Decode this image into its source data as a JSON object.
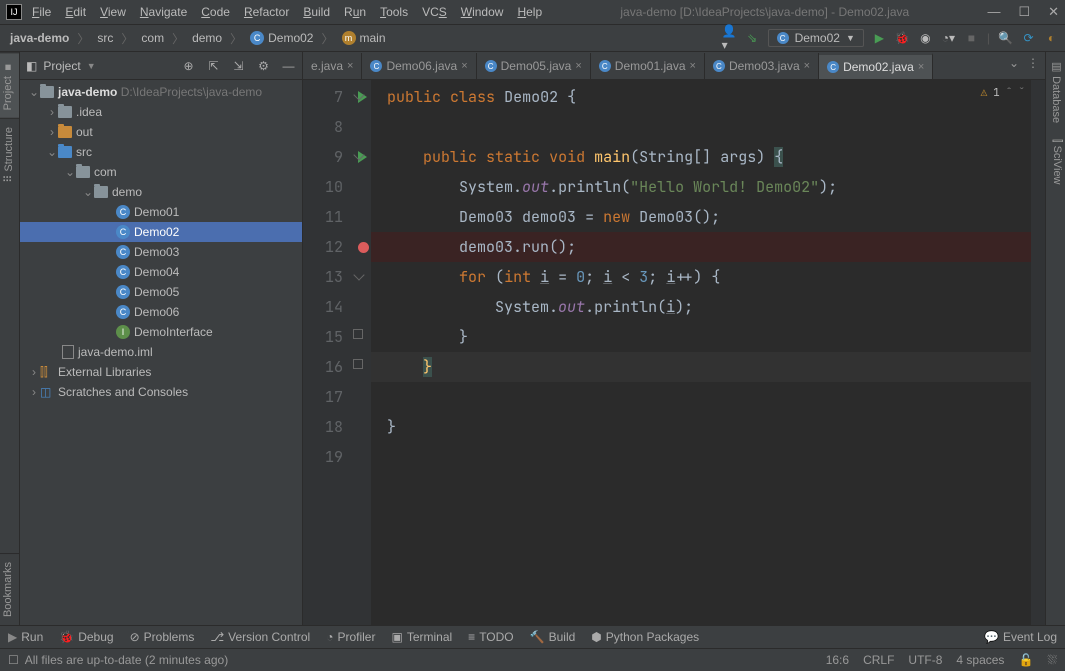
{
  "title": "java-demo [D:\\IdeaProjects\\java-demo] - Demo02.java",
  "menu": [
    "File",
    "Edit",
    "View",
    "Navigate",
    "Code",
    "Refactor",
    "Build",
    "Run",
    "Tools",
    "VCS",
    "Window",
    "Help"
  ],
  "breadcrumb": {
    "project": "java-demo",
    "p1": "src",
    "p2": "com",
    "p3": "demo",
    "cls": "Demo02",
    "method": "main"
  },
  "run_config": "Demo02",
  "left_tabs": {
    "project": "Project",
    "structure": "Structure",
    "bookmarks": "Bookmarks"
  },
  "right_tabs": {
    "database": "Database",
    "sciview": "SciView"
  },
  "project_panel": {
    "title": "Project"
  },
  "tree": {
    "project_name": "java-demo",
    "project_path": "D:\\IdeaProjects\\java-demo",
    "idea": ".idea",
    "out": "out",
    "src": "src",
    "com": "com",
    "demo": "demo",
    "demo01": "Demo01",
    "demo02": "Demo02",
    "demo03": "Demo03",
    "demo04": "Demo04",
    "demo05": "Demo05",
    "demo06": "Demo06",
    "demoiface": "DemoInterface",
    "iml": "java-demo.iml",
    "external": "External Libraries",
    "scratches": "Scratches and Consoles"
  },
  "tabs": {
    "t0": "e.java",
    "t1": "Demo06.java",
    "t2": "Demo05.java",
    "t3": "Demo01.java",
    "t4": "Demo03.java",
    "t5": "Demo02.java"
  },
  "gutter_lines": [
    "7",
    "8",
    "9",
    "10",
    "11",
    "12",
    "13",
    "14",
    "15",
    "16",
    "17",
    "18",
    "19"
  ],
  "warning_count": "1",
  "bottom": {
    "run": "Run",
    "debug": "Debug",
    "problems": "Problems",
    "vcs": "Version Control",
    "profiler": "Profiler",
    "terminal": "Terminal",
    "todo": "TODO",
    "build": "Build",
    "python": "Python Packages",
    "eventlog": "Event Log"
  },
  "status": {
    "message": "All files are up-to-date (2 minutes ago)",
    "pos": "16:6",
    "lineend": "CRLF",
    "encoding": "UTF-8",
    "indent": "4 spaces"
  }
}
